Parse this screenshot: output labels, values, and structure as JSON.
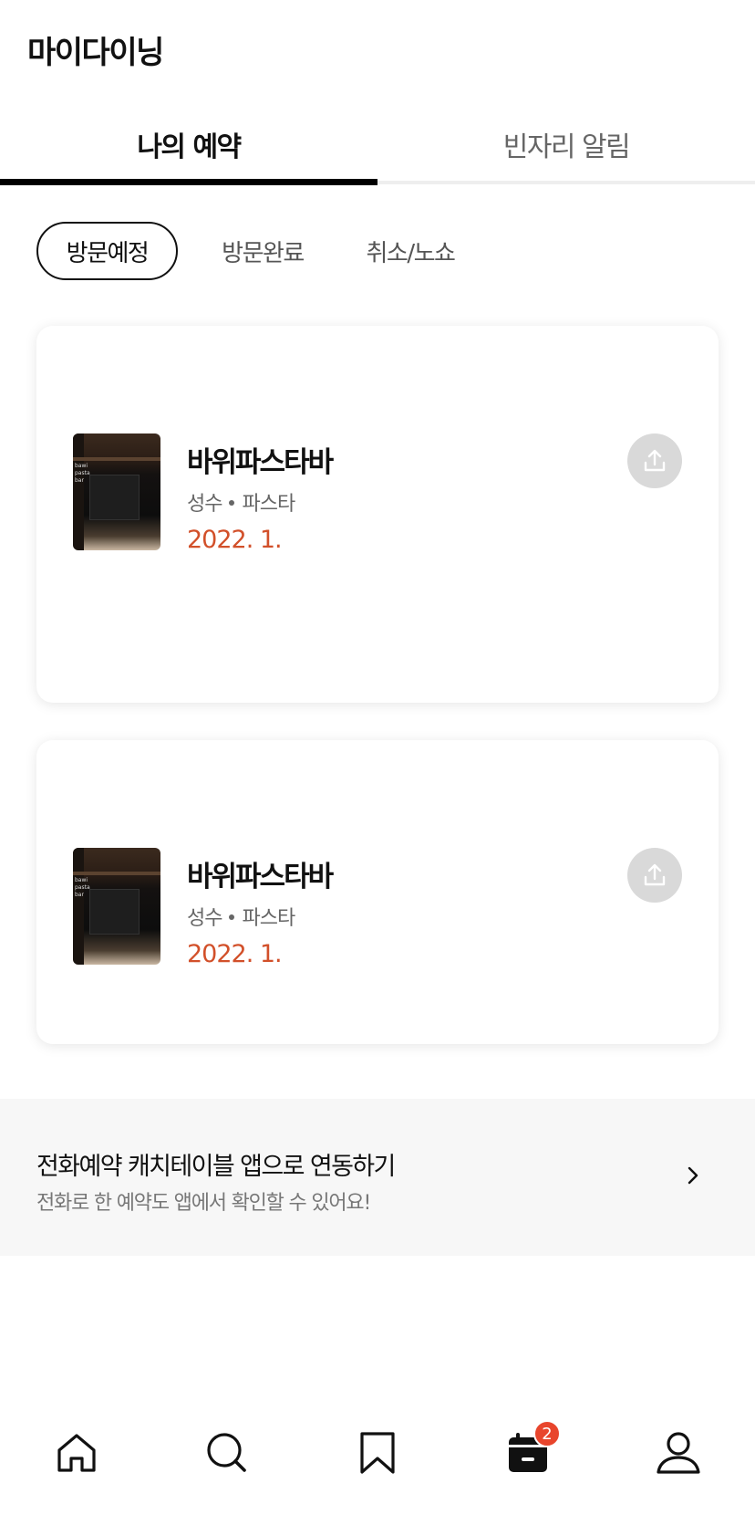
{
  "header": {
    "title": "마이다이닝"
  },
  "tabs": [
    {
      "label": "나의 예약",
      "active": true
    },
    {
      "label": "빈자리 알림",
      "active": false
    }
  ],
  "filters": [
    {
      "label": "방문예정",
      "selected": true
    },
    {
      "label": "방문완료",
      "selected": false
    },
    {
      "label": "취소/노쇼",
      "selected": false
    }
  ],
  "reservations": [
    {
      "name": "바위파스타바",
      "area": "성수",
      "category": "파스타",
      "date": "2022. 1.",
      "thumb_text": "bawi\npasta\nbar"
    },
    {
      "name": "바위파스타바",
      "area": "성수",
      "category": "파스타",
      "date": "2022. 1.",
      "thumb_text": "bawi\npasta\nbar"
    }
  ],
  "banner": {
    "title": "전화예약 캐치테이블 앱으로 연동하기",
    "subtitle": "전화로 한 예약도 앱에서 확인할 수 있어요!",
    "icon": "chevron-right-icon"
  },
  "bottom_nav": {
    "items": [
      {
        "icon": "home-icon"
      },
      {
        "icon": "search-icon"
      },
      {
        "icon": "bookmark-icon"
      },
      {
        "icon": "calendar-icon",
        "active": true
      },
      {
        "icon": "profile-icon"
      }
    ],
    "badge_count": "2"
  },
  "colors": {
    "accent": "#d2502a",
    "badge": "#e8452c",
    "share_button": "#d9d9d9"
  }
}
